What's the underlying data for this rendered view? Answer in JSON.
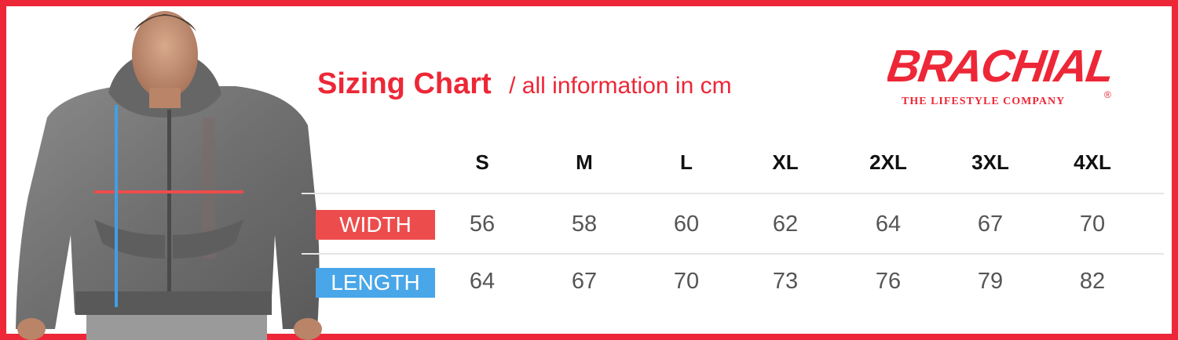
{
  "title": "Sizing Chart",
  "subtitle": "/ all information in cm",
  "brand": {
    "name": "BRACHIAL",
    "tagline": "THE LIFESTYLE COMPANY",
    "registered_mark": "®",
    "color": "#ed2737"
  },
  "colors": {
    "frame": "#ed2737",
    "width_label_bg": "#ed4c4c",
    "length_label_bg": "#49a6e8",
    "width_measure_line": "#ed4c4c",
    "length_measure_line": "#3ea0e6"
  },
  "model_image": "model-wearing-grey-hoodie",
  "sizes": [
    "S",
    "M",
    "L",
    "XL",
    "2XL",
    "3XL",
    "4XL"
  ],
  "rows": [
    {
      "label": "WIDTH",
      "values": [
        "56",
        "58",
        "60",
        "62",
        "64",
        "67",
        "70"
      ]
    },
    {
      "label": "LENGTH",
      "values": [
        "64",
        "67",
        "70",
        "73",
        "76",
        "79",
        "82"
      ]
    }
  ]
}
